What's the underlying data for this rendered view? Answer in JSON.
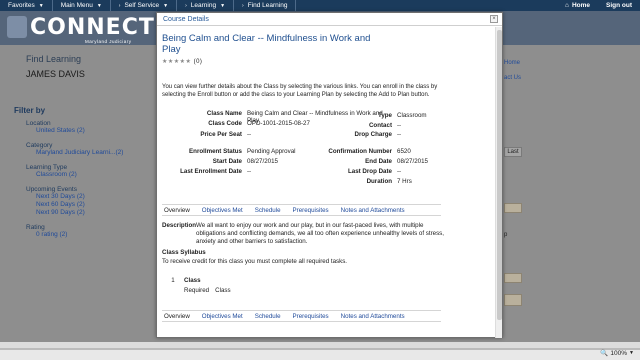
{
  "topnav": {
    "menus": [
      "Favorites",
      "Main Menu",
      "Self Service",
      "Learning"
    ],
    "breadcrumb": "Find Learning",
    "home": "Home",
    "signout": "Sign out"
  },
  "brand": {
    "name": "CONNECT",
    "sub": "Maryland Judiciary"
  },
  "page": {
    "title": "Find Learning",
    "user": "JAMES DAVIS",
    "filter_by": "Filter by",
    "filters": [
      {
        "head": "Location",
        "links": [
          "United States (2)"
        ]
      },
      {
        "head": "Category",
        "links": [
          "Maryland Judiciary Learni...(2)"
        ]
      },
      {
        "head": "Learning Type",
        "links": [
          "Classroom (2)"
        ]
      },
      {
        "head": "Upcoming Events",
        "links": [
          "Next 30 Days (2)",
          "Next 60 Days (2)",
          "Next 90 Days (2)"
        ]
      },
      {
        "head": "Rating",
        "links": [
          "0 rating (2)"
        ]
      }
    ],
    "right_links": [
      "Home",
      "act Us"
    ],
    "last_button": "Last",
    "partial_text": "p"
  },
  "modal": {
    "title": "Course Details",
    "close": "×",
    "course_title": "Being Calm and Clear -- Mindfulness in Work and Play",
    "stars": "★★★★★",
    "rating_count": "(0)",
    "intro": "You can view further details about the Class by selecting the various links. You can enroll in the class by selecting the Enroll button or add the class to your Learning Plan by selecting the Add to Plan button.",
    "details": {
      "class_name_label": "Class Name",
      "class_name": "Being Calm and Clear -- Mindfulness in Work and Play",
      "type_label": "Type",
      "type": "Classroom",
      "class_code_label": "Class Code",
      "class_code": "OPD-1001-2015-08-27",
      "contact_label": "Contact",
      "contact": "--",
      "price_label": "Price Per Seat",
      "price": "--",
      "drop_charge_label": "Drop Charge",
      "drop_charge": "--",
      "enrollment_status_label": "Enrollment Status",
      "enrollment_status": "Pending Approval",
      "confirmation_label": "Confirmation Number",
      "confirmation": "6520",
      "start_date_label": "Start Date",
      "start_date": "08/27/2015",
      "end_date_label": "End Date",
      "end_date": "08/27/2015",
      "last_enroll_label": "Last Enrollment Date",
      "last_enroll": "--",
      "last_drop_label": "Last Drop Date",
      "last_drop": "--",
      "duration_label": "Duration",
      "duration": "7 Hrs"
    },
    "tabs": [
      "Overview",
      "Objectives Met",
      "Schedule",
      "Prerequisites",
      "Notes and Attachments"
    ],
    "description_label": "Description",
    "description": "We all want to enjoy our work and our play, but in our fast-paced lives, with multiple obligations and conflicting demands, we all too often experience unhealthy levels of stress, anxiety and other barriers to satisfaction.",
    "syllabus_title": "Class Syllabus",
    "syllabus_text": "To receive credit for this class you must complete all required tasks.",
    "syllabus_item": {
      "number": "1",
      "kind": "Class",
      "required_label": "Required",
      "required_value": "Class"
    }
  },
  "status": {
    "zoom": "100%"
  }
}
